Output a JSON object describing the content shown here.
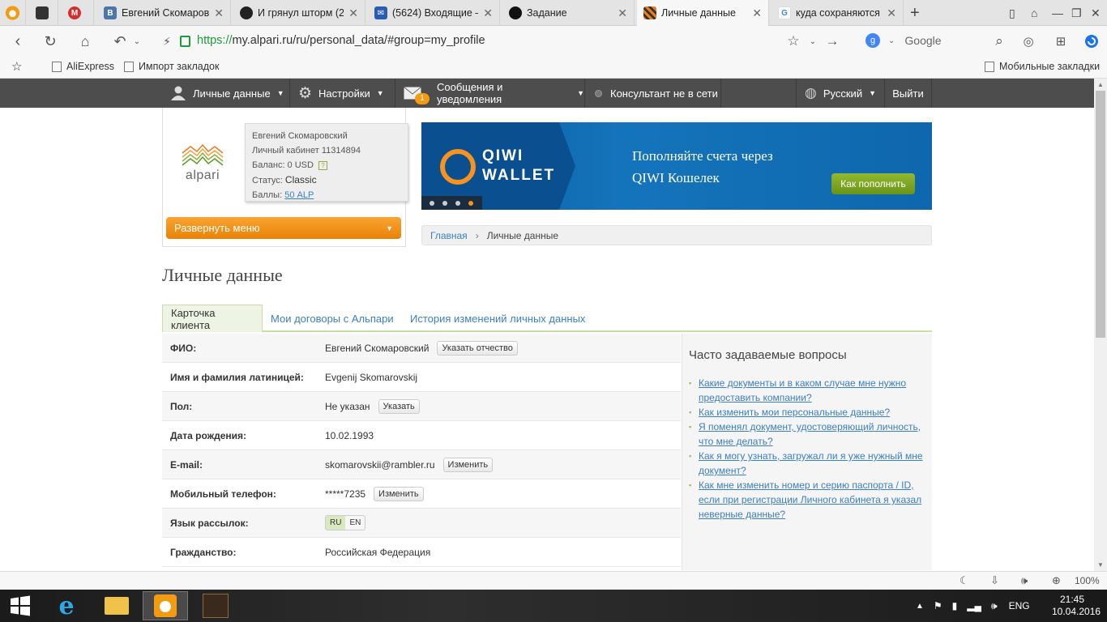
{
  "browser": {
    "tabs": [
      {
        "title": "",
        "favicon": "dark-photo"
      },
      {
        "title": "",
        "favicon": "red-m"
      },
      {
        "title": "Евгений Скомаров",
        "favicon": "vk"
      },
      {
        "title": "И грянул шторм (2",
        "favicon": "avatar"
      },
      {
        "title": "(5624) Входящие —",
        "favicon": "mail"
      },
      {
        "title": "Задание",
        "favicon": "round"
      },
      {
        "title": "Личные данные",
        "favicon": "alpari"
      },
      {
        "title": "куда сохраняются",
        "favicon": "google"
      }
    ],
    "url_scheme": "https://",
    "url_rest": "my.alpari.ru/ru/personal_data/#group=my_profile",
    "search_engine": "Google",
    "bookmarks": [
      "AliExpress",
      "Импорт закладок"
    ],
    "mobile_bookmarks": "Мобильные закладки",
    "zoom": "100%"
  },
  "sitenav": {
    "personal": "Личные данные",
    "settings": "Настройки",
    "messages": "Сообщения и уведомления",
    "messages_count": "1",
    "consultant": "Консультант не в сети",
    "language": "Русский",
    "logout": "Выйти"
  },
  "profile": {
    "logo_text": "alpari",
    "name": "Евгений Скомаровский",
    "cabinet": "Личный кабинет 11314894",
    "balance": "Баланс: 0 USD",
    "status_label": "Статус:",
    "status_value": "Classic",
    "points_label": "Баллы:",
    "points_value": "50 ALP",
    "expand_menu": "Развернуть меню"
  },
  "banner": {
    "logo_line1": "QIWI",
    "logo_line2": "WALLET",
    "text_line1": "Пополняйте счета через",
    "text_line2": "QIWI Кошелек",
    "button": "Как пополнить"
  },
  "breadcrumb": {
    "home": "Главная",
    "current": "Личные данные"
  },
  "page_title": "Личные данные",
  "tabs": [
    "Карточка клиента",
    "Мои договоры с Альпари",
    "История изменений личных данных"
  ],
  "fields": [
    {
      "label": "ФИО:",
      "value": "Евгений Скомаровский",
      "action": "Указать отчество"
    },
    {
      "label": "Имя и фамилия латиницей:",
      "value": "Evgenij Skomarovskij",
      "action": ""
    },
    {
      "label": "Пол:",
      "value": "Не указан",
      "action": "Указать"
    },
    {
      "label": "Дата рождения:",
      "value": "10.02.1993",
      "action": ""
    },
    {
      "label": "E-mail:",
      "value": "skomarovskii@rambler.ru",
      "action": "Изменить"
    },
    {
      "label": "Мобильный телефон:",
      "value": "*****7235",
      "action": "Изменить"
    },
    {
      "label": "Язык рассылок:",
      "value": "",
      "action": ""
    },
    {
      "label": "Гражданство:",
      "value": "Российская Федерация",
      "action": ""
    }
  ],
  "mail_langs": [
    "RU",
    "EN"
  ],
  "faq": {
    "title": "Часто задаваемые вопросы",
    "items": [
      "Какие документы и в каком случае мне нужно предоставить компании?",
      "Как изменить мои персональные данные?",
      "Я поменял документ, удостоверяющий личность, что мне делать?",
      "Как я могу узнать, загружал ли я уже нужный мне документ?",
      "Как мне изменить номер и серию паспорта / ID, если при регистрации Личного кабинета я указал неверные данные?"
    ]
  },
  "taskbar": {
    "lang": "ENG",
    "time": "21:45",
    "date": "10.04.2016"
  },
  "colors": {
    "brand_orange": "#ea8106",
    "nav_dark": "#4d4d4d",
    "link": "#3a7fc1",
    "qiwi_blue": "#1474bb"
  }
}
